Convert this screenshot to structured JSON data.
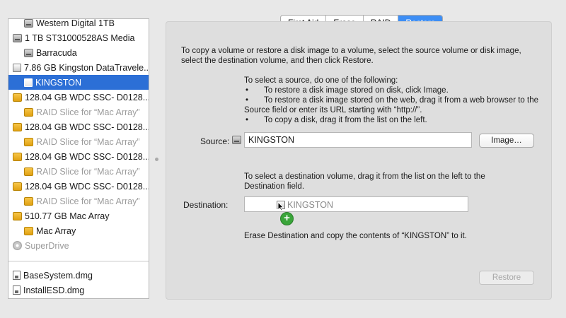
{
  "sidebar": {
    "items": [
      {
        "label": "Western Digital 1TB",
        "icon": "hdd-icon",
        "indent": 1,
        "style": "normal"
      },
      {
        "label": "1 TB ST31000528AS Media",
        "icon": "hdd-icon",
        "indent": 0,
        "style": "normal"
      },
      {
        "label": "Barracuda",
        "icon": "hdd-icon",
        "indent": 1,
        "style": "normal"
      },
      {
        "label": "7.86 GB Kingston DataTravele...",
        "icon": "usb-drive-icon",
        "indent": 0,
        "style": "normal"
      },
      {
        "label": "KINGSTON",
        "icon": "usb-drive-icon",
        "indent": 1,
        "style": "selected"
      },
      {
        "label": "128.04 GB WDC SSC- D0128...",
        "icon": "raid-icon",
        "indent": 0,
        "style": "normal"
      },
      {
        "label": "RAID Slice for “Mac Array”",
        "icon": "raid-icon",
        "indent": 1,
        "style": "dim"
      },
      {
        "label": "128.04 GB WDC SSC- D0128...",
        "icon": "raid-icon",
        "indent": 0,
        "style": "normal"
      },
      {
        "label": "RAID Slice for “Mac Array”",
        "icon": "raid-icon",
        "indent": 1,
        "style": "dim"
      },
      {
        "label": "128.04 GB WDC SSC- D0128...",
        "icon": "raid-icon",
        "indent": 0,
        "style": "normal"
      },
      {
        "label": "RAID Slice for “Mac Array”",
        "icon": "raid-icon",
        "indent": 1,
        "style": "dim"
      },
      {
        "label": "128.04 GB WDC SSC- D0128...",
        "icon": "raid-icon",
        "indent": 0,
        "style": "normal"
      },
      {
        "label": "RAID Slice for “Mac Array”",
        "icon": "raid-icon",
        "indent": 1,
        "style": "dim"
      },
      {
        "label": "510.77 GB Mac Array",
        "icon": "raid-icon",
        "indent": 0,
        "style": "normal"
      },
      {
        "label": "Mac Array",
        "icon": "raid-icon",
        "indent": 1,
        "style": "normal"
      },
      {
        "label": "SuperDrive",
        "icon": "optical-disc-icon",
        "indent": 0,
        "style": "dim"
      }
    ],
    "images": [
      {
        "label": "BaseSystem.dmg",
        "icon": "disk-image-icon"
      },
      {
        "label": "InstallESD.dmg",
        "icon": "disk-image-icon"
      }
    ]
  },
  "tabs": [
    {
      "label": "First Aid",
      "active": false
    },
    {
      "label": "Erase",
      "active": false
    },
    {
      "label": "RAID",
      "active": false
    },
    {
      "label": "Restore",
      "active": true
    }
  ],
  "restore": {
    "intro": "To copy a volume or restore a disk image to a volume, select the source volume or disk image, select the destination volume, and then click Restore.",
    "source_instructions": {
      "heading": "To select a source, do one of the following:",
      "bullets": [
        "To restore a disk image stored on disk, click Image.",
        "To restore a disk image stored on the web, drag it from a web browser to the Source field or enter its URL starting with “http://”.",
        "To copy a disk, drag it from the list on the left."
      ],
      "bullet_char": "•"
    },
    "source_label": "Source:",
    "source_value": "KINGSTON",
    "image_button": "Image…",
    "destination_instructions": "To select a destination volume, drag it from the list on the left to the Destination field.",
    "destination_label": "Destination:",
    "destination_value": "",
    "drag_item_label": "KINGSTON",
    "drag_badge": "+",
    "erase_message": "Erase Destination and copy the contents of “KINGSTON” to it.",
    "restore_button": "Restore"
  }
}
